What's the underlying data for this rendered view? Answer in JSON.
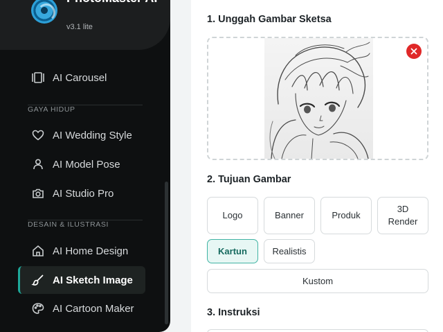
{
  "app": {
    "name": "PhotoMaster AI",
    "version": "v3.1 lite"
  },
  "sidebar": {
    "items_top": [
      {
        "label": "AI Carousel",
        "icon": "carousel-icon"
      }
    ],
    "sections": [
      {
        "label": "GAYA HIDUP",
        "items": [
          {
            "label": "AI Wedding Style",
            "icon": "heart-icon"
          },
          {
            "label": "AI Model Pose",
            "icon": "person-icon"
          },
          {
            "label": "AI Studio Pro",
            "icon": "camera-icon"
          }
        ]
      },
      {
        "label": "DESAIN & ILUSTRASI",
        "items": [
          {
            "label": "AI Home Design",
            "icon": "home-icon"
          },
          {
            "label": "AI Sketch Image",
            "icon": "brush-icon",
            "active": true
          },
          {
            "label": "AI Cartoon Maker",
            "icon": "palette-icon"
          }
        ]
      }
    ]
  },
  "main": {
    "upload": {
      "title": "1. Unggah Gambar Sketsa",
      "image": "anime-sketch-portrait"
    },
    "purpose": {
      "title": "2. Tujuan Gambar",
      "options": [
        "Logo",
        "Banner",
        "Produk",
        "3D Render",
        "Kartun",
        "Realistis",
        "Kustom"
      ],
      "selected": "Kartun"
    },
    "instructions": {
      "title": "3. Instruksi"
    }
  },
  "colors": {
    "accent": "#1ea99a",
    "danger": "#e02828",
    "sidebar_bg": "#0e1011"
  }
}
